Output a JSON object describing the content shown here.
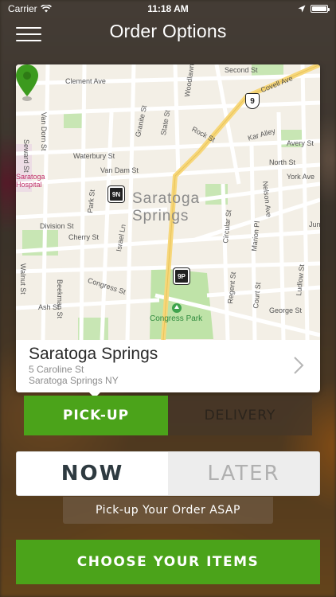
{
  "status_bar": {
    "carrier": "Carrier",
    "time": "11:18 AM"
  },
  "nav": {
    "title": "Order Options"
  },
  "map": {
    "city_label": "Saratoga Springs",
    "streets": {
      "clement": "Clement Ave",
      "vandorn": "Van Dorn St",
      "seward": "Seward St",
      "granite": "Granite St",
      "state": "State St",
      "woodlawn": "Woodlawn",
      "waterbury": "Waterbury St",
      "vandam": "Van Dam St",
      "division": "Division St",
      "cherry": "Cherry St",
      "park": "Park St",
      "israel": "Israel Ln",
      "walnut": "Walnut St",
      "beekman": "Beekman St",
      "congress": "Congress St",
      "ash": "Ash St",
      "rock": "Rock St",
      "karalley": "Kar Alley",
      "avery": "Avery St",
      "north": "North St",
      "york": "York Ave",
      "nelson": "Nelson Ave",
      "circular": "Circular St",
      "marion": "Marion Pl",
      "regent": "Regent St",
      "court": "Court St",
      "george": "George St",
      "ludlow": "Ludlow St",
      "covell": "Covell Ave",
      "second": "Second St",
      "hospital": "Saratoga Hospital",
      "jun": "Jun"
    },
    "park_label": "Congress Park",
    "badges": {
      "route_9n": "9N",
      "route_9p": "9P",
      "route_9": "9"
    },
    "colors": {
      "park": "#bfe3a8",
      "road_major": "#f7d77a",
      "road_minor": "#ffffff",
      "pin": "#3c9a1e"
    }
  },
  "location": {
    "name": "Saratoga Springs",
    "address_line1": "5 Caroline St",
    "address_line2": "Saratoga Springs NY"
  },
  "order_type": {
    "pickup_label": "PICK-UP",
    "delivery_label": "DELIVERY",
    "selected": "PICK-UP"
  },
  "timing": {
    "now_label": "NOW",
    "later_label": "LATER",
    "selected": "NOW",
    "note": "Pick-up Your Order ASAP"
  },
  "cta": {
    "label": "CHOOSE YOUR ITEMS"
  },
  "colors": {
    "accent": "#4ba31a"
  }
}
